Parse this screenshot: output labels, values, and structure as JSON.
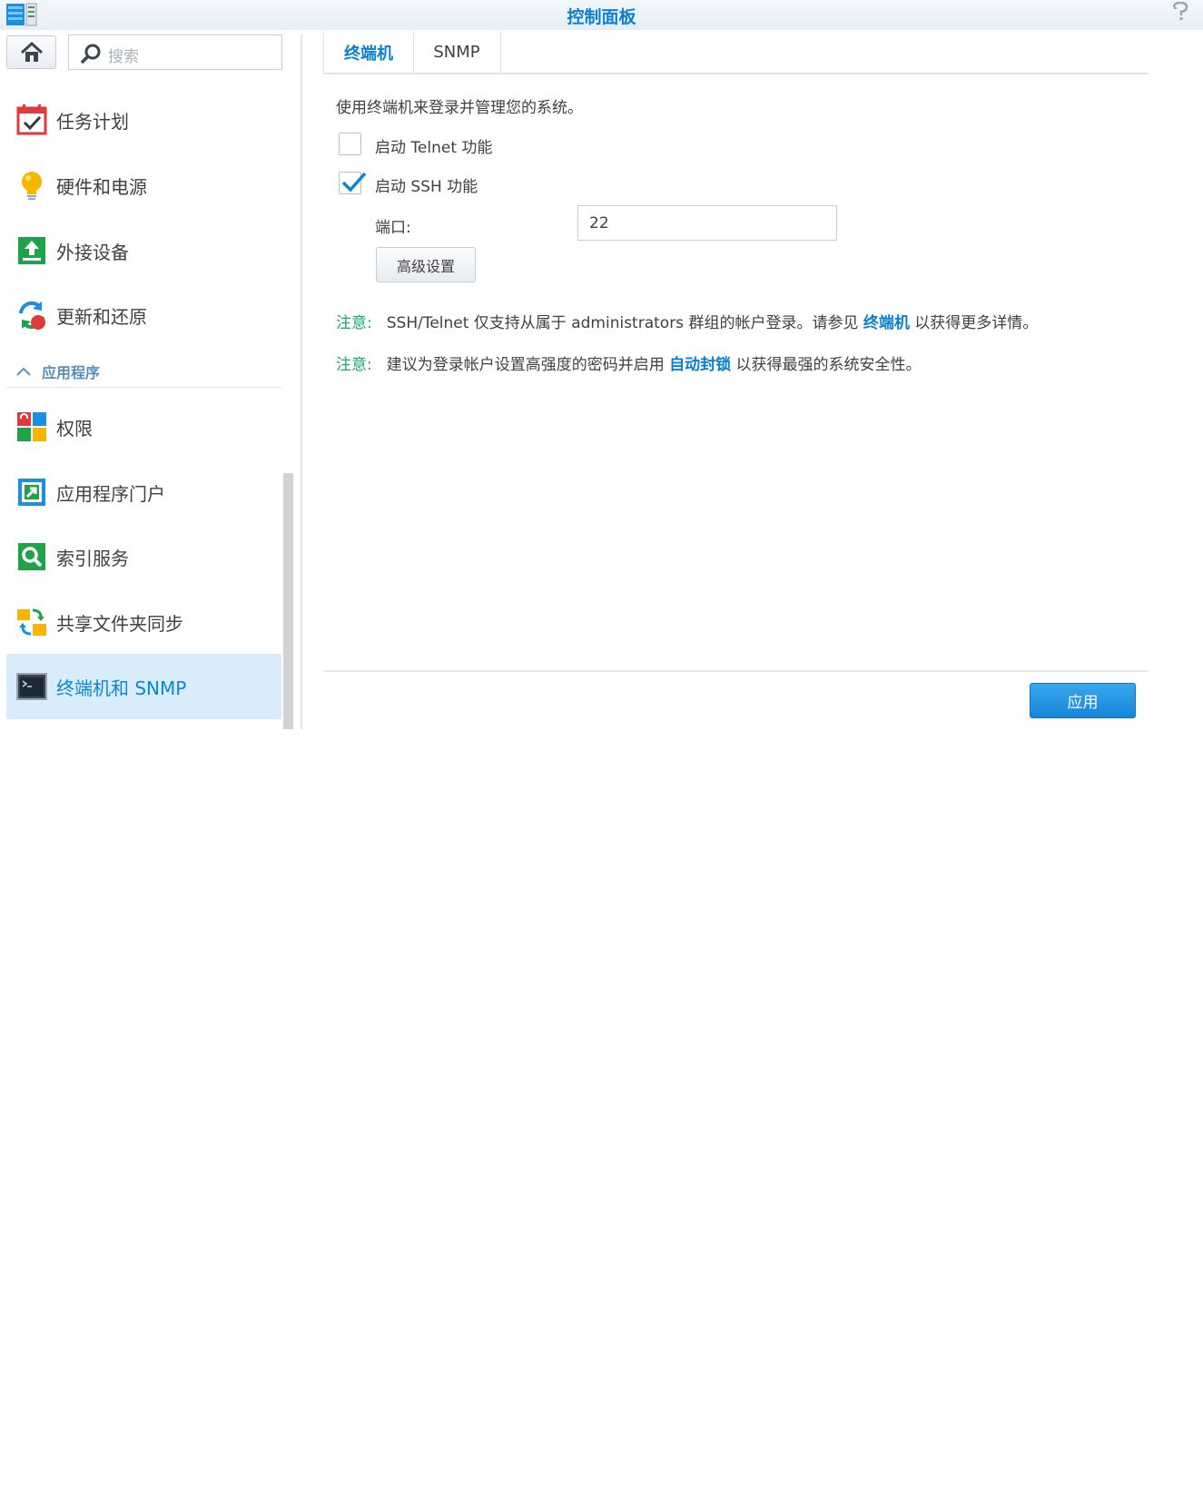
{
  "window": {
    "title": "控制面板",
    "help_icon": "help-icon"
  },
  "search": {
    "placeholder": "搜索"
  },
  "sidebar": {
    "items_top": [
      {
        "label": "任务计划",
        "icon": "task-scheduler-icon"
      },
      {
        "label": "硬件和电源",
        "icon": "lightbulb-icon"
      },
      {
        "label": "外接设备",
        "icon": "external-device-icon"
      },
      {
        "label": "更新和还原",
        "icon": "update-restore-icon"
      }
    ],
    "section": {
      "label": "应用程序",
      "icon": "chevron-up-icon"
    },
    "items_apps": [
      {
        "label": "权限",
        "icon": "privileges-icon"
      },
      {
        "label": "应用程序门户",
        "icon": "app-portal-icon"
      },
      {
        "label": "索引服务",
        "icon": "indexing-service-icon"
      },
      {
        "label": "共享文件夹同步",
        "icon": "shared-folder-sync-icon"
      },
      {
        "label": "终端机和 SNMP",
        "icon": "terminal-icon",
        "active": true
      }
    ]
  },
  "tabs": [
    {
      "label": "终端机",
      "active": true
    },
    {
      "label": "SNMP",
      "active": false
    }
  ],
  "terminal": {
    "description": "使用终端机来登录并管理您的系统。",
    "telnet": {
      "label": "启动 Telnet 功能",
      "checked": false
    },
    "ssh": {
      "label": "启动 SSH 功能",
      "checked": true
    },
    "port": {
      "label": "端口:",
      "value": "22"
    },
    "advanced_button": "高级设置"
  },
  "notes": [
    {
      "prefix": "注意:",
      "text_before": "SSH/Telnet 仅支持从属于 administrators 群组的帐户登录。请参见",
      "link": "终端机",
      "text_after": "以获得更多详情。"
    },
    {
      "prefix": "注意:",
      "text_before": "建议为登录帐户设置高强度的密码并启用",
      "link": "自动封锁",
      "text_after": "以获得最强的系统安全性。"
    }
  ],
  "footer": {
    "apply_button": "应用"
  },
  "colors": {
    "accent": "#0b7fd1",
    "note": "#1aa57a",
    "active_bg": "#d9ecfa"
  }
}
